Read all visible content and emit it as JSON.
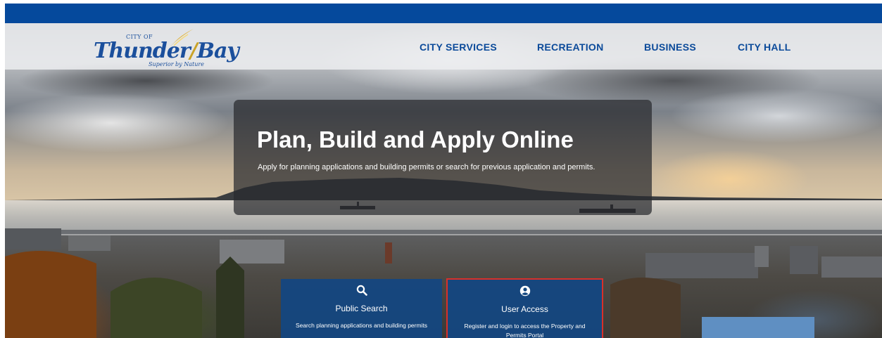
{
  "brand": {
    "city_of": "CITY OF",
    "name_part1": "Thunder",
    "name_part2": "Bay",
    "tagline": "Superior by Nature",
    "primary_color": "#05499c",
    "accent_color": "#c9a227"
  },
  "nav": {
    "items": [
      {
        "label": "CITY SERVICES"
      },
      {
        "label": "RECREATION"
      },
      {
        "label": "BUSINESS"
      },
      {
        "label": "CITY HALL"
      }
    ]
  },
  "hero": {
    "title": "Plan, Build and Apply Online",
    "subtitle": "Apply for planning applications and building permits or search for previous application and permits."
  },
  "cards": [
    {
      "icon": "search-icon",
      "title": "Public Search",
      "description": "Search planning applications and building permits"
    },
    {
      "icon": "user-circle-icon",
      "title": "User Access",
      "description": "Register and login to access the Property and Permits Portal",
      "highlight_color": "#d9302a"
    }
  ]
}
